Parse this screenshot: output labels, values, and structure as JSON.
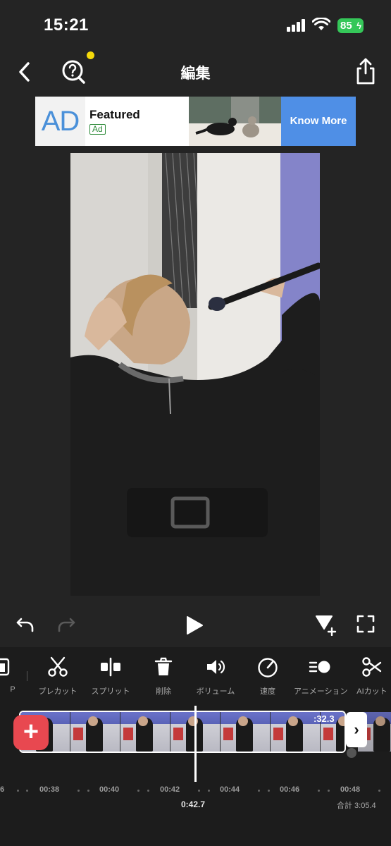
{
  "status_bar": {
    "time": "15:21",
    "battery": "85"
  },
  "header": {
    "title": "編集"
  },
  "ad": {
    "logo_text": "AD",
    "title": "Featured",
    "badge": "Ad",
    "cta": "Know More"
  },
  "tools": [
    {
      "label": "P",
      "icon": "pip-icon"
    },
    {
      "label": "プレカット",
      "icon": "scissors-icon"
    },
    {
      "label": "スプリット",
      "icon": "split-icon"
    },
    {
      "label": "削除",
      "icon": "trash-icon"
    },
    {
      "label": "ボリューム",
      "icon": "volume-icon"
    },
    {
      "label": "速度",
      "icon": "speedometer-icon"
    },
    {
      "label": "アニメーション",
      "icon": "animation-icon"
    },
    {
      "label": "AIカット",
      "icon": "ai-cut-icon"
    }
  ],
  "timeline": {
    "clip_duration": ":32.3",
    "ruler": [
      "6",
      "00:38",
      "00:40",
      "00:42",
      "00:44",
      "00:46",
      "00:48"
    ],
    "current_time": "0:42.7",
    "total": "合計 3:05.4"
  },
  "colors": {
    "accent_red": "#e84850",
    "battery_green": "#35c759",
    "ad_blue": "#4f8fe6"
  }
}
